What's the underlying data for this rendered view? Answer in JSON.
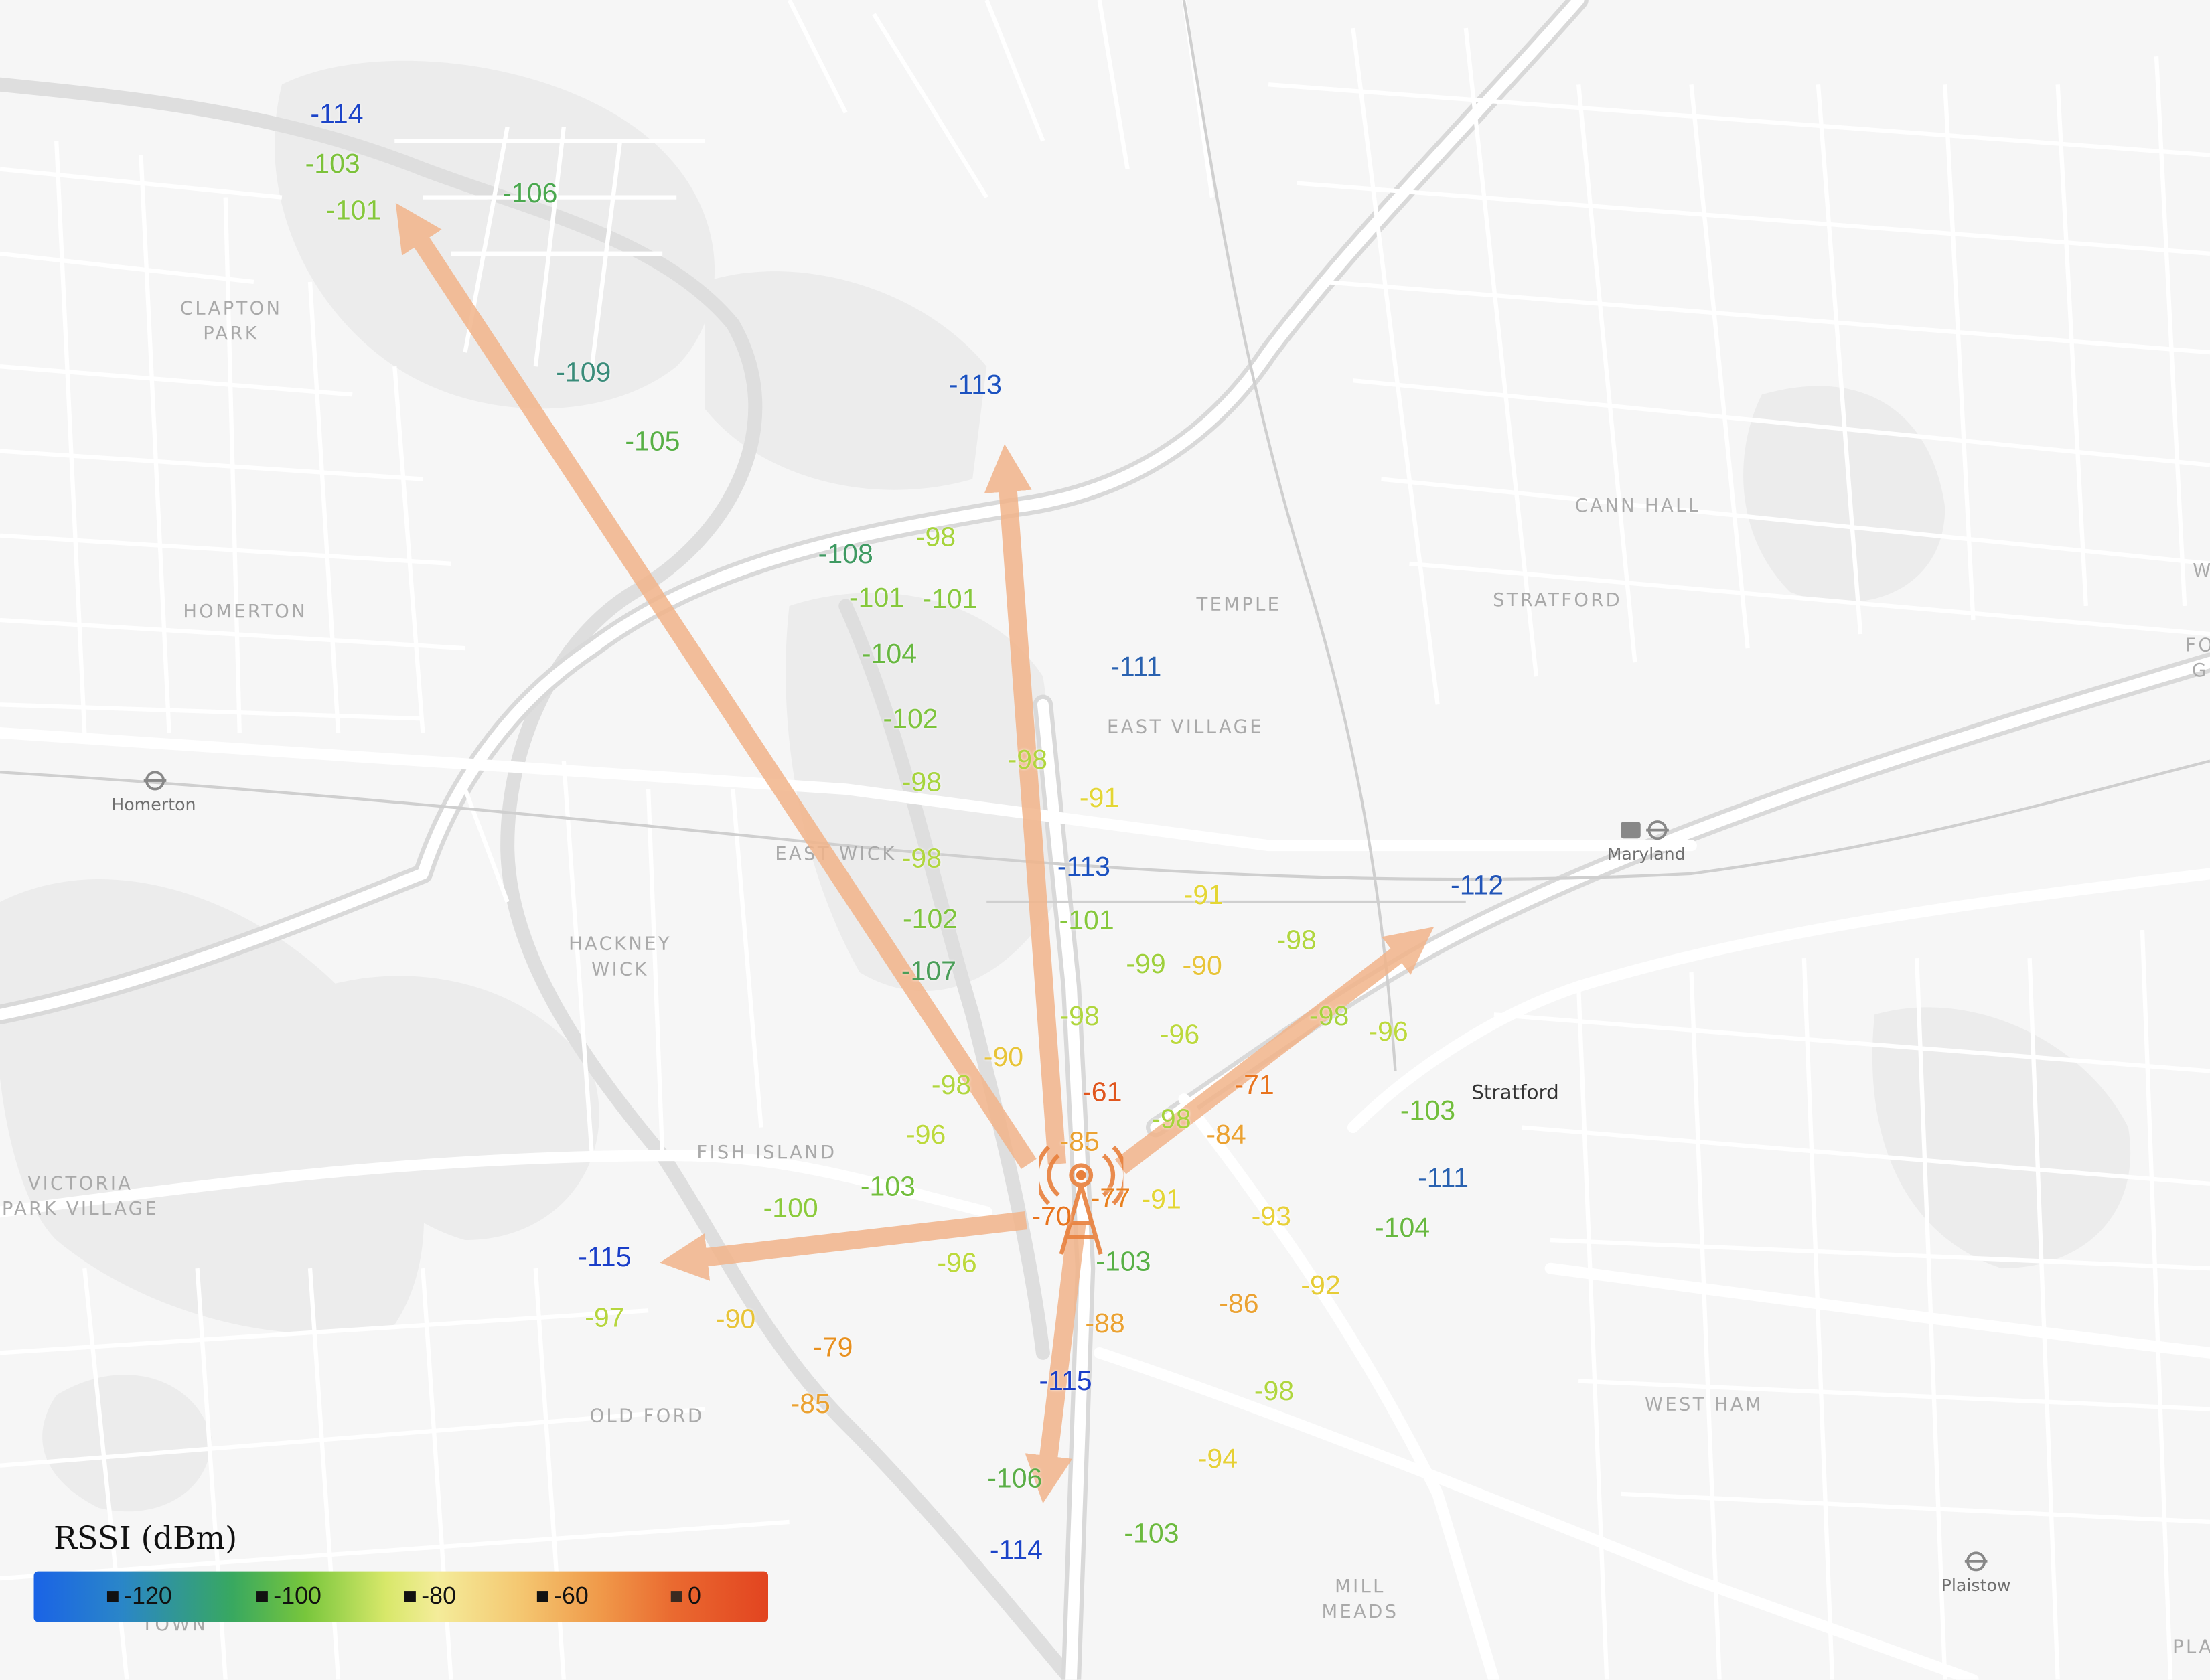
{
  "map": {
    "places": [
      {
        "id": "clapton-park",
        "text": "CLAPTON\nPARK"
      },
      {
        "id": "homerton",
        "text": "HOMERTON"
      },
      {
        "id": "temple-mills",
        "text": "TEMPLE"
      },
      {
        "id": "cann-hall",
        "text": "CANN HALL"
      },
      {
        "id": "stratford-district",
        "text": "STRATFORD"
      },
      {
        "id": "east-village",
        "text": "EAST VILLAGE"
      },
      {
        "id": "east-wick",
        "text": "EAST WICK"
      },
      {
        "id": "hackney-wick",
        "text": "HACKNEY\nWICK"
      },
      {
        "id": "fish-island",
        "text": "FISH ISLAND"
      },
      {
        "id": "victoria-park-village",
        "text": "VICTORIA\nPARK VILLAGE"
      },
      {
        "id": "old-ford",
        "text": "OLD FORD"
      },
      {
        "id": "west-ham",
        "text": "WEST HAM"
      },
      {
        "id": "mill-meads",
        "text": "MILL\nMEADS"
      },
      {
        "id": "bow-town",
        "text": "TOWN"
      },
      {
        "id": "plaistow-edge",
        "text": "PLA"
      },
      {
        "id": "edge-w",
        "text": "W"
      },
      {
        "id": "edge-fo",
        "text": "FO\nG"
      }
    ],
    "stations": [
      {
        "id": "homerton",
        "text": "Homerton"
      },
      {
        "id": "maryland",
        "text": "Maryland"
      },
      {
        "id": "plaistow",
        "text": "Plaistow"
      }
    ],
    "town_label": "Stratford"
  },
  "rssi_readings": [
    {
      "value": "-114",
      "color": "#1c44c8"
    },
    {
      "value": "-103",
      "color": "#7cc23a"
    },
    {
      "value": "-101",
      "color": "#86c83c"
    },
    {
      "value": "-106",
      "color": "#4aa84e"
    },
    {
      "value": "-109",
      "color": "#3a8c7a"
    },
    {
      "value": "-105",
      "color": "#58b046"
    },
    {
      "value": "-113",
      "color": "#1c52c0"
    },
    {
      "value": "-108",
      "color": "#3f9a62"
    },
    {
      "value": "-98",
      "color": "#a6d43c"
    },
    {
      "value": "-101",
      "color": "#86c83c"
    },
    {
      "value": "-101",
      "color": "#86c83c"
    },
    {
      "value": "-104",
      "color": "#68b840"
    },
    {
      "value": "-111",
      "color": "#2a62b0"
    },
    {
      "value": "-102",
      "color": "#7ec43c"
    },
    {
      "value": "-98",
      "color": "#b0d63e"
    },
    {
      "value": "-91",
      "color": "#e4d634"
    },
    {
      "value": "-98",
      "color": "#a6d43c"
    },
    {
      "value": "-113",
      "color": "#1c52c0"
    },
    {
      "value": "-91",
      "color": "#e4d634"
    },
    {
      "value": "-112",
      "color": "#2255b8"
    },
    {
      "value": "-102",
      "color": "#7ec43c"
    },
    {
      "value": "-101",
      "color": "#86c83c"
    },
    {
      "value": "-98",
      "color": "#b0d63e"
    },
    {
      "value": "-107",
      "color": "#4a9e58"
    },
    {
      "value": "-99",
      "color": "#9ed03c"
    },
    {
      "value": "-90",
      "color": "#e8c438"
    },
    {
      "value": "-98",
      "color": "#b0d63e"
    },
    {
      "value": "-96",
      "color": "#bcd93c"
    },
    {
      "value": "-98",
      "color": "#b0d63e"
    },
    {
      "value": "-96",
      "color": "#bcd93c"
    },
    {
      "value": "-90",
      "color": "#e8c438"
    },
    {
      "value": "-61",
      "color": "#e0561e"
    },
    {
      "value": "-71",
      "color": "#e8741e"
    },
    {
      "value": "-98",
      "color": "#a6d43c"
    },
    {
      "value": "-98",
      "color": "#b0d63e"
    },
    {
      "value": "-85",
      "color": "#eba232"
    },
    {
      "value": "-84",
      "color": "#eba232"
    },
    {
      "value": "-103",
      "color": "#72be3c"
    },
    {
      "value": "-96",
      "color": "#bcd93c"
    },
    {
      "value": "-111",
      "color": "#2a62b0"
    },
    {
      "value": "-103",
      "color": "#72be3c"
    },
    {
      "value": "-77",
      "color": "#e8801e"
    },
    {
      "value": "-91",
      "color": "#e4d634"
    },
    {
      "value": "-98",
      "color": "#a6d43c"
    },
    {
      "value": "-100",
      "color": "#8cca3c"
    },
    {
      "value": "-70",
      "color": "#e8741e"
    },
    {
      "value": "-93",
      "color": "#e8d038"
    },
    {
      "value": "-104",
      "color": "#68b840"
    },
    {
      "value": "-115",
      "color": "#1a3ec8"
    },
    {
      "value": "-96",
      "color": "#bcd93c"
    },
    {
      "value": "-103",
      "color": "#58b046"
    },
    {
      "value": "-92",
      "color": "#e6cc36"
    },
    {
      "value": "-97",
      "color": "#b6d63e"
    },
    {
      "value": "-90",
      "color": "#e8c438"
    },
    {
      "value": "-86",
      "color": "#eba232"
    },
    {
      "value": "-88",
      "color": "#eba232"
    },
    {
      "value": "-79",
      "color": "#e8901e"
    },
    {
      "value": "-115",
      "color": "#1a3ec8"
    },
    {
      "value": "-98",
      "color": "#b0d63e"
    },
    {
      "value": "-85",
      "color": "#eba232"
    },
    {
      "value": "-94",
      "color": "#e6d036"
    },
    {
      "value": "-106",
      "color": "#5aae46"
    },
    {
      "value": "-103",
      "color": "#6cba3e"
    },
    {
      "value": "-114",
      "color": "#1c44c8"
    }
  ],
  "legend": {
    "title": "RSSI (dBm)",
    "ticks": [
      "-120",
      "-100",
      "-80",
      "-60",
      "0"
    ],
    "gradient": [
      "#1a63e6",
      "#38a860",
      "#f4ec9a",
      "#f09a4a",
      "#e24420"
    ]
  },
  "colors": {
    "arrow": "#f2b48a",
    "tower": "#e8803c",
    "water": "#e6e6e6",
    "road": "#ffffff"
  },
  "icons": {
    "transmitter": "radio-tower-icon",
    "rail_station": "rail-station-icon"
  }
}
